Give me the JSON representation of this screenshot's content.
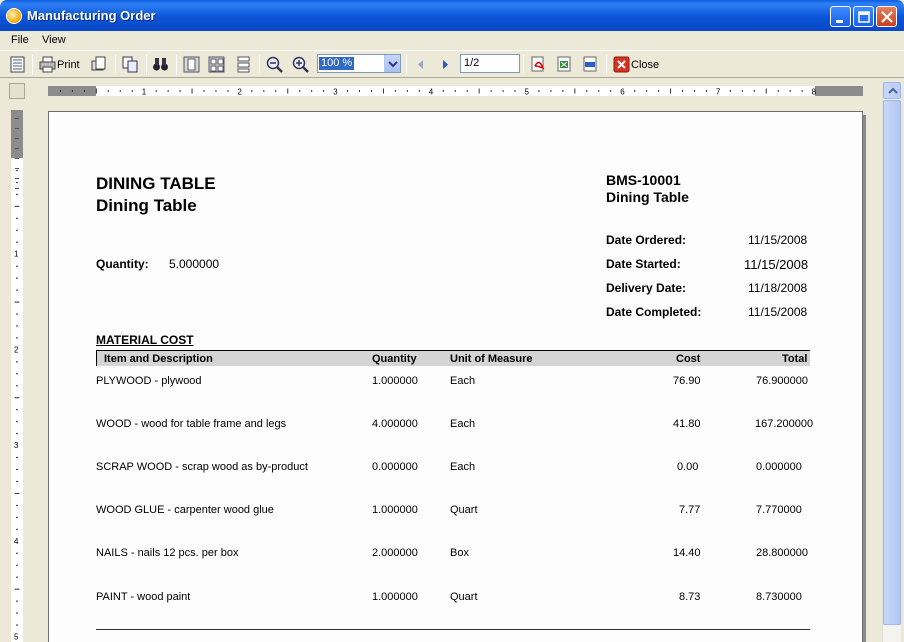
{
  "window": {
    "title": "Manufacturing Order"
  },
  "menu": {
    "file": "File",
    "view": "View"
  },
  "toolbar": {
    "print_label": "Print",
    "zoom_value": "100 %",
    "page_value": "1/2",
    "close_label": "Close"
  },
  "ruler": {
    "h_labels": [
      "1",
      "2",
      "3",
      "4",
      "5",
      "6",
      "7",
      "8"
    ],
    "v_labels": [
      "1",
      "2",
      "3",
      "4",
      "5"
    ]
  },
  "report": {
    "product_title": "DINING TABLE",
    "product_subtitle": "Dining Table",
    "order_number": "BMS-10001",
    "order_product": "Dining Table",
    "quantity_label": "Quantity:",
    "quantity_value": "5.000000",
    "dates": [
      {
        "label": "Date Ordered:",
        "value": "11/15/2008"
      },
      {
        "label": "Date Started:",
        "value": "11/15/2008"
      },
      {
        "label": "Delivery Date:",
        "value": "11/18/2008"
      },
      {
        "label": "Date Completed:",
        "value": "11/15/2008"
      }
    ],
    "section_title": "MATERIAL COST",
    "columns": {
      "item": "Item and Description",
      "quantity": "Quantity",
      "uom": "Unit of Measure",
      "cost": "Cost",
      "total": "Total"
    },
    "rows": [
      {
        "item": "PLYWOOD - plywood",
        "quantity": "1.000000",
        "uom": "Each",
        "cost": "76.90",
        "total": "76.900000"
      },
      {
        "item": "WOOD - wood for table frame and legs",
        "quantity": "4.000000",
        "uom": "Each",
        "cost": "41.80",
        "total": "167.200000"
      },
      {
        "item": "SCRAP WOOD - scrap wood as by-product",
        "quantity": "0.000000",
        "uom": "Each",
        "cost": "0.00",
        "total": "0.000000"
      },
      {
        "item": "WOOD GLUE - carpenter wood glue",
        "quantity": "1.000000",
        "uom": "Quart",
        "cost": "7.77",
        "total": "7.770000"
      },
      {
        "item": "NAILS - nails 12 pcs. per box",
        "quantity": "2.000000",
        "uom": "Box",
        "cost": "14.40",
        "total": "28.800000"
      },
      {
        "item": "PAINT - wood paint",
        "quantity": "1.000000",
        "uom": "Quart",
        "cost": "8.73",
        "total": "8.730000"
      }
    ]
  }
}
